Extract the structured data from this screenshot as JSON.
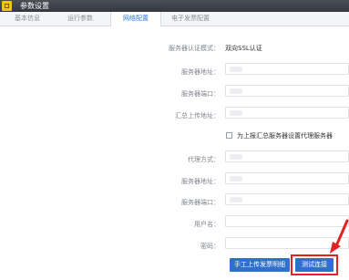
{
  "window": {
    "title": "参数设置"
  },
  "tabs": [
    {
      "label": "基本信息"
    },
    {
      "label": "运行参数"
    },
    {
      "label": "网络配置"
    },
    {
      "label": "电子发票配置"
    }
  ],
  "form": {
    "auth_mode_label": "服务器认证模式：",
    "auth_mode_value": "双向SSL认证",
    "server_addr_label": "服务器地址：",
    "server_port_label": "服务器端口：",
    "upload_addr_label": "汇总上传地址：",
    "proxy_checkbox_label": "为上报汇总服务器设置代理服务器",
    "proxy_mode_label": "代理方式：",
    "proxy_server_addr_label": "服务器地址：",
    "proxy_server_port_label": "服务器端口：",
    "username_label": "用户名：",
    "password_label": "密码："
  },
  "buttons": {
    "manual_upload": "手工上传发票明细",
    "test_connection": "测试连接"
  },
  "colors": {
    "accent": "#2f6fd0",
    "highlight": "#e02424"
  }
}
